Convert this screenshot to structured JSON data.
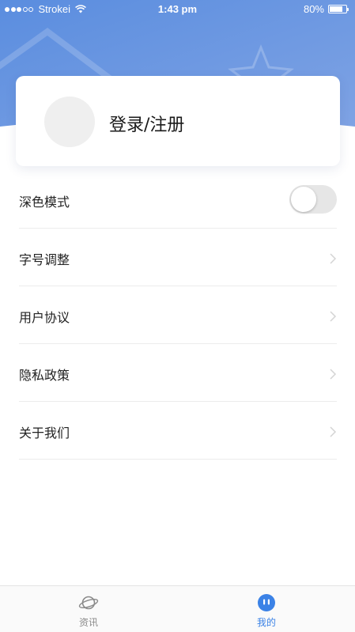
{
  "status_bar": {
    "carrier": "Strokei",
    "time": "1:43 pm",
    "battery": "80%",
    "battery_level": 0.8,
    "signal_bars": 3
  },
  "profile": {
    "login_label": "登录/注册"
  },
  "settings": {
    "dark_mode": {
      "label": "深色模式",
      "enabled": false
    },
    "items": [
      {
        "label": "字号调整"
      },
      {
        "label": "用户协议"
      },
      {
        "label": "隐私政策"
      },
      {
        "label": "关于我们"
      }
    ]
  },
  "tab_bar": {
    "tabs": [
      {
        "label": "资讯",
        "icon": "planet-icon",
        "active": false
      },
      {
        "label": "我的",
        "icon": "face-icon",
        "active": true
      }
    ]
  },
  "colors": {
    "header_gradient_start": "#5b8fde",
    "header_gradient_end": "#7ea5e6",
    "accent": "#3b82e6",
    "inactive": "#8a8a8a"
  }
}
